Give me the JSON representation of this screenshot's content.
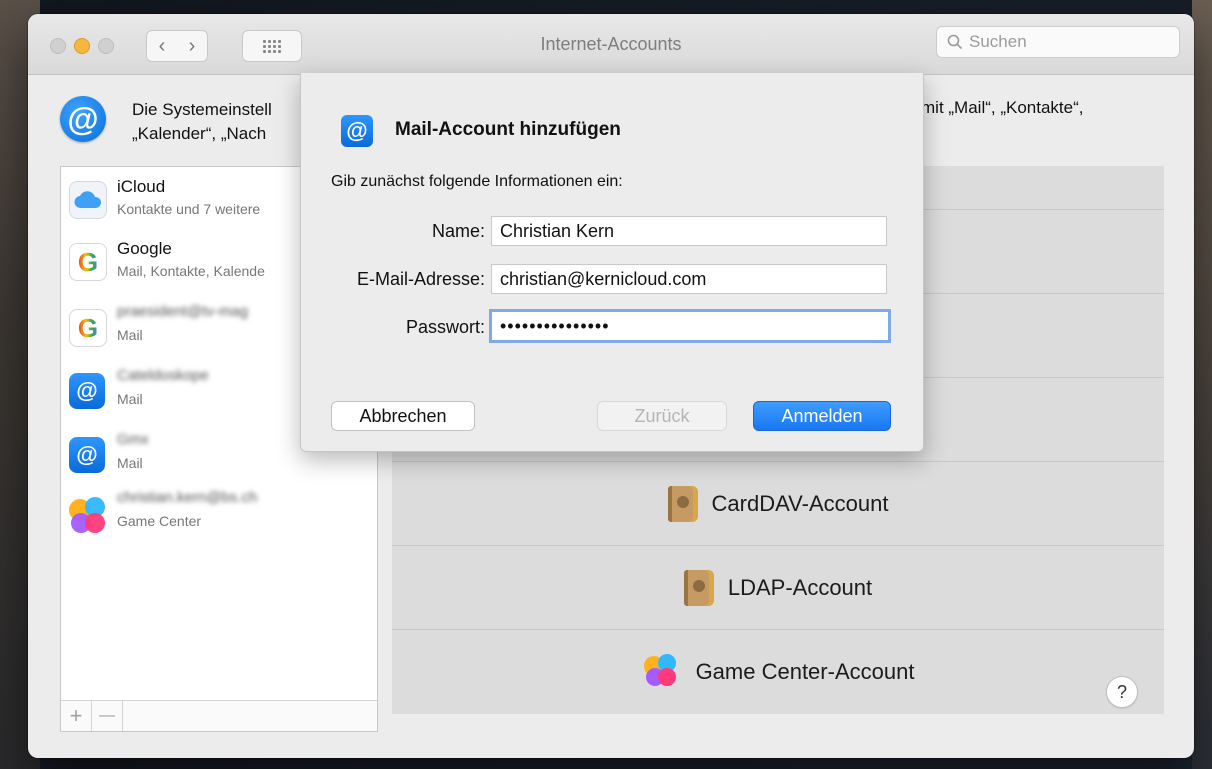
{
  "window": {
    "title": "Internet-Accounts"
  },
  "search": {
    "placeholder": "Suchen"
  },
  "header": {
    "text_line1": "Die Systemeinstell",
    "text_line2": "„Kalender“, „Nach",
    "text_right": "mit „Mail“, „Kontakte“,"
  },
  "sidebar": {
    "accounts": [
      {
        "name": "iCloud",
        "detail": "Kontakte und 7 weitere",
        "icon": "icloud-icon"
      },
      {
        "name": "Google",
        "detail": "Mail, Kontakte, Kalende",
        "icon": "google-icon"
      },
      {
        "name": "praesident@tv-mag",
        "detail": "Mail",
        "icon": "google-icon",
        "blurred": true
      },
      {
        "name": "Cateldoskope",
        "detail": "Mail",
        "icon": "mail-icon",
        "blurred": true
      },
      {
        "name": "Gmx",
        "detail": "Mail",
        "icon": "mail-icon",
        "blurred": true
      },
      {
        "name": "christian.kern@bs.ch",
        "detail": "Game Center",
        "icon": "game-center-icon",
        "blurred": true
      }
    ],
    "add_label": "+",
    "remove_label": "—"
  },
  "providers": [
    {
      "label": "CardDAV-Account",
      "icon": "address-book-icon"
    },
    {
      "label": "LDAP-Account",
      "icon": "address-book-icon"
    },
    {
      "label": "Game Center-Account",
      "icon": "game-center-icon"
    }
  ],
  "help_label": "?",
  "dialog": {
    "title": "Mail-Account hinzufügen",
    "intro": "Gib zunächst folgende Informationen ein:",
    "fields": {
      "name_label": "Name:",
      "name_value": "Christian Kern",
      "email_label": "E-Mail-Adresse:",
      "email_value": "christian@kernicloud.com",
      "password_label": "Passwort:",
      "password_value": "•••••••••••••••"
    },
    "buttons": {
      "cancel": "Abbrechen",
      "back": "Zurück",
      "sign_in": "Anmelden"
    }
  }
}
